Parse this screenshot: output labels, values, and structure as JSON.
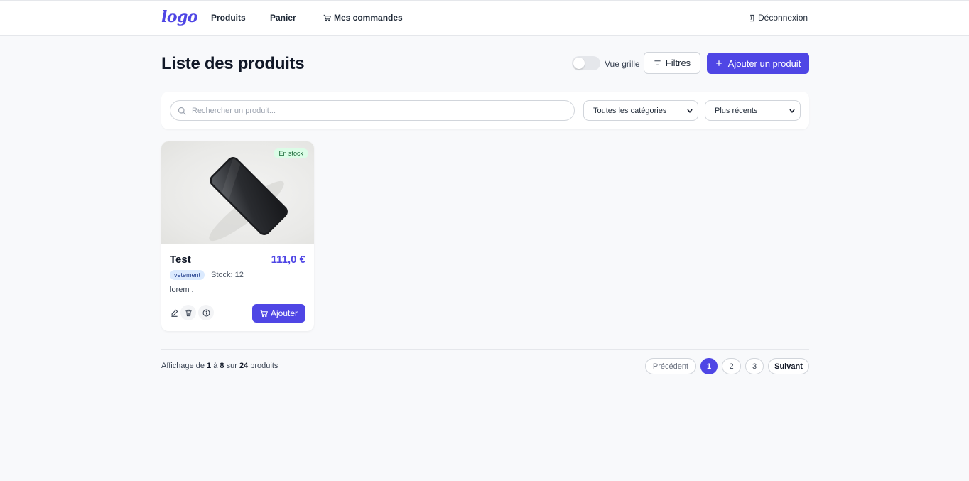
{
  "nav": {
    "logo": "logo",
    "links": [
      "Produits",
      "Panier",
      "Mes commandes"
    ],
    "logout": "Déconnexion"
  },
  "header": {
    "title": "Liste des produits",
    "view_toggle_label": "Vue grille",
    "filters_label": "Filtres",
    "add_label": "Ajouter un produit"
  },
  "filters": {
    "search_placeholder": "Rechercher un produit...",
    "search_value": "",
    "category": "Toutes les catégories",
    "sort": "Plus récents"
  },
  "products": [
    {
      "name": "Test",
      "price": "111,0 €",
      "badge": "En stock",
      "category": "vetement",
      "stock": "Stock: 12",
      "description": "lorem .",
      "cart_label": "Ajouter"
    }
  ],
  "pagination": {
    "prefix": "Affichage de",
    "from": "1",
    "between": "à",
    "to": "8",
    "of": "sur",
    "total": "24",
    "suffix": "produits",
    "prev": "Précédent",
    "pages": [
      "1",
      "2",
      "3"
    ],
    "next": "Suivant"
  },
  "colors": {
    "accent": "#4f46e5",
    "stock_badge_bg": "#dcfce7",
    "category_badge_bg": "#dbeafe",
    "background": "#f8f9fb"
  }
}
